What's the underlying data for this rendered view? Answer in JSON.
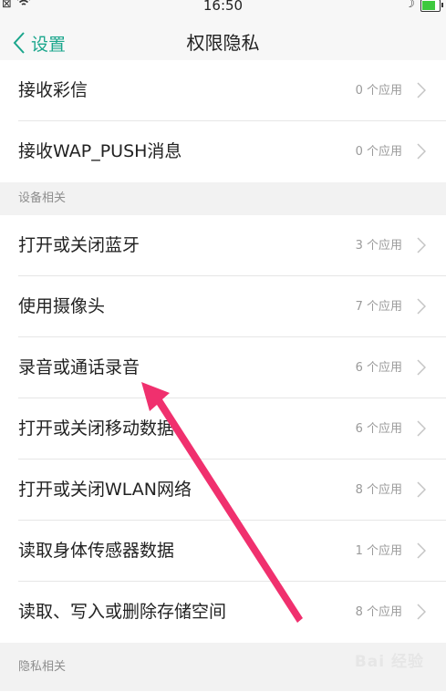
{
  "status_bar": {
    "time": "16:50",
    "left_icon": "⊠",
    "moon_icon": "☽",
    "battery_level_percent": 90,
    "battery_color": "#3ec93e"
  },
  "nav": {
    "back_label": "设置",
    "title": "权限隐私",
    "accent_color": "#1aa68c"
  },
  "items_top": [
    {
      "label": "接收彩信",
      "count": "0 个应用"
    },
    {
      "label": "接收WAP_PUSH消息",
      "count": "0 个应用"
    }
  ],
  "section_device": {
    "title": "设备相关"
  },
  "items_device": [
    {
      "label": "打开或关闭蓝牙",
      "count": "3 个应用"
    },
    {
      "label": "使用摄像头",
      "count": "7 个应用"
    },
    {
      "label": "录音或通话录音",
      "count": "6 个应用"
    },
    {
      "label": "打开或关闭移动数据",
      "count": "6 个应用"
    },
    {
      "label": "打开或关闭WLAN网络",
      "count": "8 个应用"
    },
    {
      "label": "读取身体传感器数据",
      "count": "1 个应用"
    },
    {
      "label": "读取、写入或删除存储空间",
      "count": "8 个应用"
    }
  ],
  "section_privacy": {
    "title": "隐私相关"
  },
  "annotation": {
    "arrow_color": "#f0306e"
  },
  "watermark": {
    "text": "Bai 经验"
  }
}
